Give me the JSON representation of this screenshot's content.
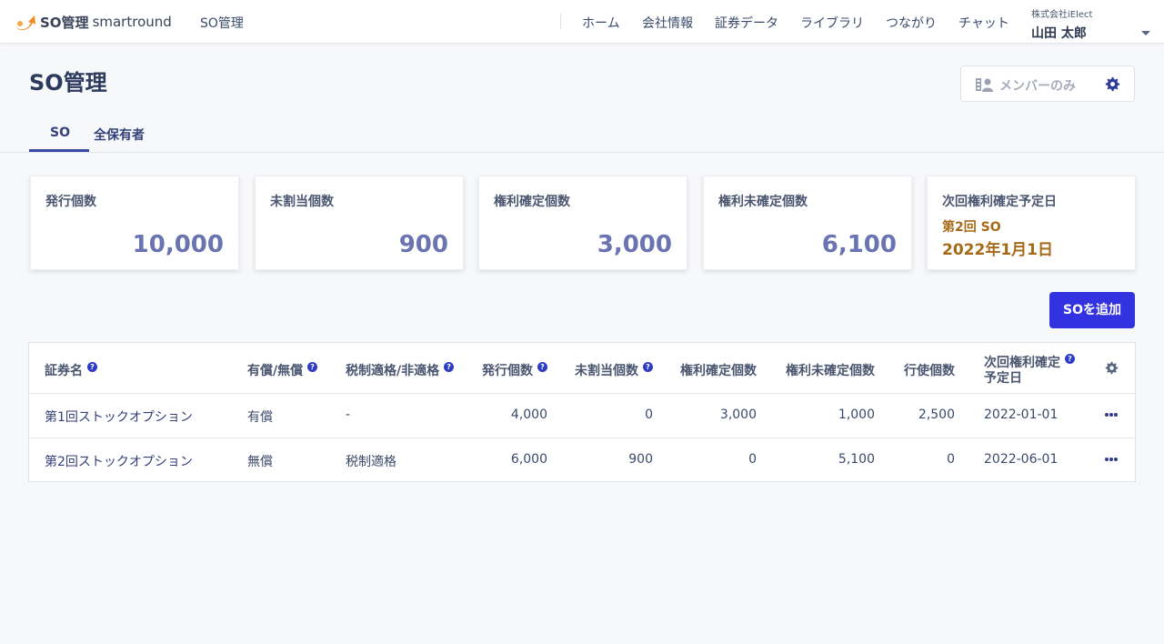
{
  "header": {
    "logo_so": "SO管理",
    "logo_brand": "smartround",
    "app_name": "SO管理",
    "nav": [
      "ホーム",
      "会社情報",
      "証券データ",
      "ライブラリ",
      "つながり",
      "チャット"
    ],
    "company": "株式会社iElect",
    "user": "山田 太郎"
  },
  "page": {
    "title": "SO管理",
    "member_filter": "メンバーのみ",
    "tabs": [
      "SO",
      "全保有者"
    ],
    "add_button": "SOを追加"
  },
  "stats": [
    {
      "label": "発行個数",
      "value": "10,000"
    },
    {
      "label": "未割当個数",
      "value": "900"
    },
    {
      "label": "権利確定個数",
      "value": "3,000"
    },
    {
      "label": "権利未確定個数",
      "value": "6,100"
    },
    {
      "label": "次回権利確定予定日",
      "sub1": "第2回 SO",
      "sub2": "2022年1月1日"
    }
  ],
  "table": {
    "columns": [
      "証券名",
      "有償/無償",
      "税制適格/非適格",
      "発行個数",
      "未割当個数",
      "権利確定個数",
      "権利未確定個数",
      "行使個数",
      "次回権利確定",
      "予定日"
    ],
    "rows": [
      [
        "第1回ストックオプション",
        "有償",
        "-",
        "4,000",
        "0",
        "3,000",
        "1,000",
        "2,500",
        "2022-01-01"
      ],
      [
        "第2回ストックオプション",
        "無償",
        "税制適格",
        "6,000",
        "900",
        "0",
        "5,100",
        "0",
        "2022-06-01"
      ]
    ]
  },
  "colors": {
    "primary": "#3232e0",
    "stat_value": "#6a74b0",
    "next_date": "#a66a17",
    "logo_accent": "#f08a1c"
  },
  "icons": {
    "logo": "arrow-swoosh-icon",
    "member": "people-icon",
    "settings": "gear-icon",
    "help": "question-circle-icon",
    "row_menu": "more-horizontal-icon",
    "dropdown": "caret-down-icon"
  }
}
